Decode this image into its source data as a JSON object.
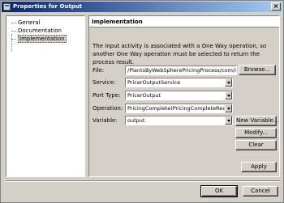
{
  "window": {
    "title": "Properties for Output"
  },
  "tree": {
    "items": [
      "General",
      "Documentation",
      "Implementation"
    ],
    "selected": "Implementation"
  },
  "panel": {
    "title": "Implementation",
    "info": "The input activity is associated with a One Way operation, so another One Way operation must be selected to return the process result.",
    "file": {
      "label": "File:",
      "value": "/PlantsByWebSpherePricingProcess/com/ib",
      "browse": "Browse..."
    },
    "service": {
      "label": "Service:",
      "value": "PricerOutputService"
    },
    "port_type": {
      "label": "Port Type:",
      "value": "PricerOutput"
    },
    "operation": {
      "label": "Operation:",
      "value": "PricingComplete(PricingCompleteReques"
    },
    "variable": {
      "label": "Variable:",
      "value": "output",
      "new": "New Variable...",
      "modify": "Modify...",
      "clear": "Clear"
    },
    "apply": "Apply"
  },
  "footer": {
    "ok": "OK",
    "cancel": "Cancel"
  }
}
